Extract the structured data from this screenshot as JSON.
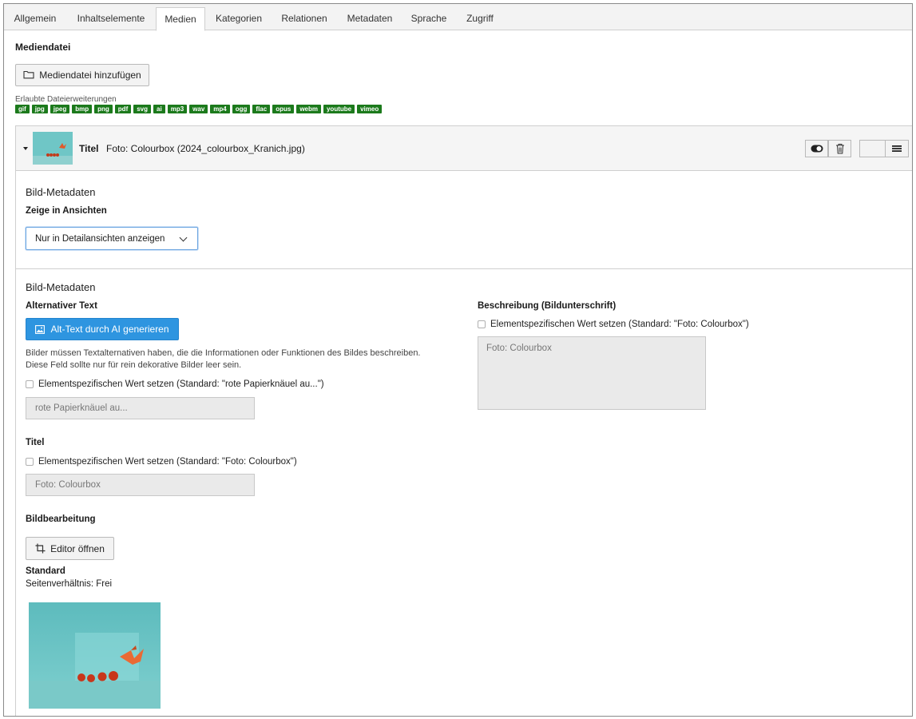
{
  "tabs": [
    {
      "label": "Allgemein"
    },
    {
      "label": "Inhaltselemente"
    },
    {
      "label": "Medien"
    },
    {
      "label": "Kategorien"
    },
    {
      "label": "Relationen"
    },
    {
      "label": "Metadaten"
    },
    {
      "label": "Sprache"
    },
    {
      "label": "Zugriff"
    }
  ],
  "active_tab": "Medien",
  "media": {
    "title": "Mediendatei",
    "add_button": "Mediendatei hinzufügen",
    "allowed_label": "Erlaubte Dateierweiterungen",
    "extensions": [
      "gif",
      "jpg",
      "jpeg",
      "bmp",
      "png",
      "pdf",
      "svg",
      "ai",
      "mp3",
      "wav",
      "mp4",
      "ogg",
      "flac",
      "opus",
      "webm",
      "youtube",
      "vimeo"
    ],
    "extension_color": "#1c7a1c"
  },
  "file": {
    "header_label": "Titel",
    "header_value": "Foto: Colourbox (2024_colourbox_Kranich.jpg)",
    "meta1_title": "Bild-Metadaten",
    "show_in_views_label": "Zeige in Ansichten",
    "show_in_views_value": "Nur in Detailansichten anzeigen",
    "meta2_title": "Bild-Metadaten",
    "alt": {
      "label": "Alternativer Text",
      "ai_button": "Alt-Text durch AI generieren",
      "help": "Bilder müssen Textalternativen haben, die die Informationen oder Funktionen des Bildes beschreiben. Diese Feld sollte nur für rein dekorative Bilder leer sein.",
      "checkbox": "Elementspezifischen Wert setzen (Standard: \"rote Papierknäuel au...\")",
      "placeholder": "rote Papierknäuel au..."
    },
    "title": {
      "label": "Titel",
      "checkbox": "Elementspezifischen Wert setzen (Standard: \"Foto: Colourbox\")",
      "placeholder": "Foto: Colourbox"
    },
    "description": {
      "label": "Beschreibung (Bildunterschrift)",
      "checkbox": "Elementspezifischen Wert setzen (Standard: \"Foto: Colourbox\")",
      "placeholder": "Foto: Colourbox"
    },
    "editing": {
      "label": "Bildbearbeitung",
      "button": "Editor öffnen",
      "variant": "Standard",
      "ratio": "Seitenverhältnis: Frei"
    }
  },
  "colors": {
    "ai_button": "#2e95e0",
    "select_focus": "#6aa4e0"
  }
}
